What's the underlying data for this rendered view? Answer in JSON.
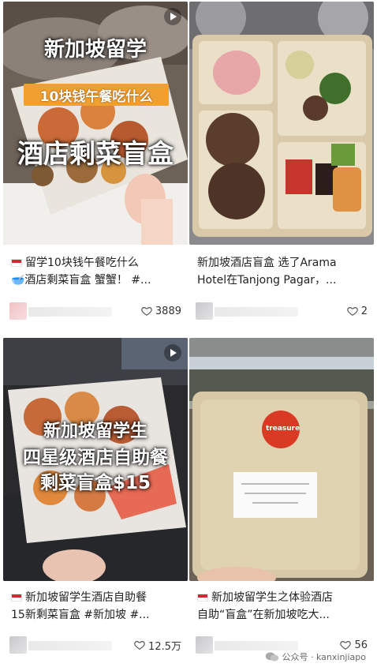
{
  "cards": [
    {
      "overlay": {
        "line1": "新加坡留学",
        "line2": "10块钱午餐吃什么",
        "line3": "酒店剩菜盲盒"
      },
      "title_line1": "留学10块钱午餐吃什么",
      "title_line2": "🥣酒店剩菜盲盒 蟹蟹！ #...",
      "likes": "3889",
      "has_flag": true,
      "is_video": true
    },
    {
      "title_line1": "新加坡酒店盲盒 选了Arama",
      "title_line2": "Hotel在Tanjong Pagar，...",
      "likes": "2",
      "has_flag": false,
      "is_video": false
    },
    {
      "overlay": {
        "line1": "新加坡留学生",
        "line2": "四星级酒店自助餐",
        "line3": "剩菜盲盒$15"
      },
      "title_line1": "新加坡留学生酒店自助餐",
      "title_line2": "15新剩菜盲盒 #新加坡 #...",
      "likes": "12.5万",
      "has_flag": true,
      "is_video": true
    },
    {
      "box_label": "treasure",
      "title_line1": "新加坡留学生之体验酒店",
      "title_line2": "自助“盲盒”在新加坡吃大...",
      "likes": "56",
      "has_flag": true,
      "is_video": false
    }
  ],
  "watermark": {
    "label": "公众号 · kanxinjiapo"
  },
  "colors": {
    "overlay_text": "#ffffff",
    "overlay_band": "#f0a030",
    "heart": "#555555",
    "flag_red": "#d7262f"
  },
  "icons": {
    "like": "heart-outline-icon",
    "video": "play-icon",
    "flag": "singapore-flag-icon"
  }
}
